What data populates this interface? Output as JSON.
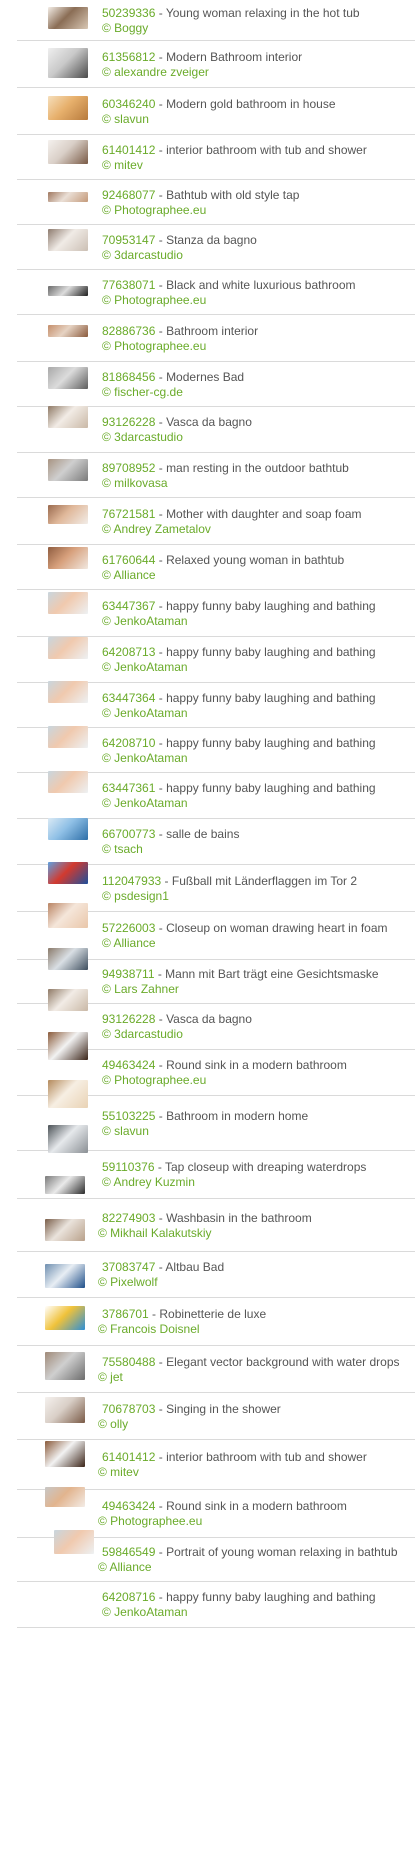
{
  "accent_color": "#6aab2a",
  "text_color": "#555555",
  "separator": " - ",
  "items": [
    {
      "id": "50239336",
      "title": "Young woman relaxing in the hot tub",
      "credit": "© Boggy",
      "thumb": "woman-hot-tub-thumbnail",
      "colors": [
        "#d8c7b4",
        "#8a6d55",
        "#f3ede6"
      ]
    },
    {
      "id": "61356812",
      "title": "Modern Bathroom interior",
      "credit": "© alexandre zveiger",
      "thumb": "bathroom-interior-thumbnail",
      "colors": [
        "#4a4a4a",
        "#c9c9c9",
        "#efefef"
      ]
    },
    {
      "id": "60346240",
      "title": "Modern gold bathroom in house",
      "credit": "© slavun",
      "thumb": "gold-bathroom-thumbnail",
      "colors": [
        "#b77a3c",
        "#e7b06c",
        "#f6dfbc"
      ]
    },
    {
      "id": "61401412",
      "title": "interior bathroom with tub and shower",
      "credit": "© mitev",
      "thumb": "bathroom-tub-shower-thumbnail",
      "colors": [
        "#7a5a46",
        "#d9cfc7",
        "#f5f1ee"
      ]
    },
    {
      "id": "92468077",
      "title": "Bathtub with old style tap",
      "credit": "© Photographee.eu",
      "thumb": "bathtub-tap-thumbnail",
      "colors": [
        "#c49a7a",
        "#eadfd6",
        "#a07860"
      ]
    },
    {
      "id": "70953147",
      "title": "Stanza da bagno",
      "credit": "© 3darcastudio",
      "thumb": "stanza-da-bagno-thumbnail",
      "colors": [
        "#cbbfb4",
        "#f0ebe6",
        "#8d7b6e"
      ]
    },
    {
      "id": "77638071",
      "title": "Black and white luxurious bathroom",
      "credit": "© Photographee.eu",
      "thumb": "black-white-bathroom-thumbnail",
      "colors": [
        "#1e1e1e",
        "#dcdcdc",
        "#6a6a6a"
      ]
    },
    {
      "id": "82886736",
      "title": "Bathroom interior",
      "credit": "© Photographee.eu",
      "thumb": "bathroom-interior-2-thumbnail",
      "colors": [
        "#8a5a3c",
        "#e6d3c3",
        "#c58e6b"
      ]
    },
    {
      "id": "81868456",
      "title": "Modernes Bad",
      "credit": "© fischer-cg.de",
      "thumb": "modernes-bad-thumbnail",
      "colors": [
        "#5e5e5e",
        "#dcdcdc",
        "#a8a8a8"
      ]
    },
    {
      "id": "93126228",
      "title": "Vasca da bagno",
      "credit": "© 3darcastudio",
      "thumb": "vasca-da-bagno-thumbnail",
      "colors": [
        "#c9b8a6",
        "#f2ece6",
        "#8f7a66"
      ]
    },
    {
      "id": "89708952",
      "title": "man resting in the outdoor bathtub",
      "credit": "© milkovasa",
      "thumb": "man-outdoor-bathtub-thumbnail",
      "colors": [
        "#7a7a7a",
        "#cfcfcf",
        "#a89482"
      ]
    },
    {
      "id": "76721581",
      "title": "Mother with daughter and soap foam",
      "credit": "© Andrey Zametalov",
      "thumb": "mother-daughter-foam-thumbnail",
      "colors": [
        "#f2ede8",
        "#e0b89a",
        "#9a6a4e"
      ]
    },
    {
      "id": "61760644",
      "title": "Relaxed young woman in bathtub",
      "credit": "© Alliance",
      "thumb": "woman-bathtub-thumbnail",
      "colors": [
        "#f1e8e0",
        "#d7a07c",
        "#8f5d40"
      ]
    },
    {
      "id": "63447367",
      "title": "happy funny baby laughing and bathing",
      "credit": "© JenkoAtaman",
      "thumb": "baby-bathing-thumbnail",
      "colors": [
        "#eef1f3",
        "#f0c9ae",
        "#c9d6de"
      ]
    },
    {
      "id": "64208713",
      "title": "happy funny baby laughing and bathing",
      "credit": "© JenkoAtaman",
      "thumb": "baby-bathing-thumbnail",
      "colors": [
        "#eef1f3",
        "#f0c9ae",
        "#c9d6de"
      ]
    },
    {
      "id": "63447364",
      "title": "happy funny baby laughing and bathing",
      "credit": "© JenkoAtaman",
      "thumb": "baby-bathing-thumbnail",
      "colors": [
        "#eef1f3",
        "#f0c9ae",
        "#c9d6de"
      ]
    },
    {
      "id": "64208710",
      "title": "happy funny baby laughing and bathing",
      "credit": "© JenkoAtaman",
      "thumb": "baby-bathing-thumbnail",
      "colors": [
        "#eef1f3",
        "#f0c9ae",
        "#c9d6de"
      ]
    },
    {
      "id": "63447361",
      "title": "happy funny baby laughing and bathing",
      "credit": "© JenkoAtaman",
      "thumb": "baby-bathing-thumbnail",
      "colors": [
        "#eef1f3",
        "#f0c9ae",
        "#c9d6de"
      ]
    },
    {
      "id": "66700773",
      "title": "salle de bains",
      "credit": "© tsach",
      "thumb": "salle-de-bains-thumbnail",
      "colors": [
        "#2e6fa8",
        "#8fc0e6",
        "#dbeaf5"
      ]
    },
    {
      "id": "112047933",
      "title": "Fußball mit Länderflaggen im Tor 2",
      "credit": "© psdesign1",
      "thumb": "football-flags-thumbnail",
      "colors": [
        "#1d4f9c",
        "#d23a2f",
        "#5fa0e0"
      ]
    },
    {
      "id": "57226003",
      "title": "Closeup on woman drawing heart in foam",
      "credit": "© Alliance",
      "thumb": "woman-heart-foam-thumbnail",
      "colors": [
        "#e9c6a9",
        "#f5e6da",
        "#b98464"
      ]
    },
    {
      "id": "94938711",
      "title": "Mann mit Bart trägt eine Gesichtsmaske",
      "credit": "© Lars Zahner",
      "thumb": "man-beard-mask-thumbnail",
      "colors": [
        "#3e4e5e",
        "#d9dfe4",
        "#8a7a6a"
      ]
    },
    {
      "id": "93126228",
      "title": "Vasca da bagno",
      "credit": "© 3darcastudio",
      "thumb": "vasca-da-bagno-thumbnail",
      "colors": [
        "#c9b8a6",
        "#f2ece6",
        "#8f7a66"
      ]
    },
    {
      "id": "49463424",
      "title": "Round sink in a modern bathroom",
      "credit": "© Photographee.eu",
      "thumb": "round-sink-thumbnail",
      "colors": [
        "#3b2418",
        "#f2f2f2",
        "#8a5a3a"
      ]
    },
    {
      "id": "55103225",
      "title": "Bathroom in modern home",
      "credit": "© slavun",
      "thumb": "bathroom-modern-home-thumbnail",
      "colors": [
        "#e9d2b4",
        "#f7efe3",
        "#b48a5c"
      ]
    },
    {
      "id": "59110376",
      "title": "Tap closeup with dreaping waterdrops",
      "credit": "© Andrey Kuzmin",
      "thumb": "tap-closeup-thumbnail",
      "colors": [
        "#8a8f94",
        "#e6e9ec",
        "#4b5156"
      ]
    },
    {
      "id": "82274903",
      "title": "Washbasin in the bathroom",
      "credit": "© Mikhail Kalakutskiy",
      "thumb": "washbasin-thumbnail",
      "colors": [
        "#2b2b2b",
        "#eaeaea",
        "#7a7a7a"
      ]
    },
    {
      "id": "37083747",
      "title": "Altbau Bad",
      "credit": "© Pixelwolf",
      "thumb": "altbau-bad-thumbnail",
      "colors": [
        "#b8a08a",
        "#eae3dc",
        "#7a5e4a"
      ]
    },
    {
      "id": "3786701",
      "title": "Robinetterie de luxe",
      "credit": "© Francois Doisnel",
      "thumb": "robinetterie-thumbnail",
      "colors": [
        "#1f4f8a",
        "#e8eef4",
        "#6f8fb0"
      ]
    },
    {
      "id": "75580488",
      "title": "Elegant vector background with water drops",
      "credit": "© jet",
      "thumb": "vector-water-drops-thumbnail",
      "colors": [
        "#2d8fd6",
        "#f0c23a",
        "#ffffff"
      ]
    },
    {
      "id": "70678703",
      "title": "Singing in the shower",
      "credit": "© olly",
      "thumb": "singing-shower-thumbnail",
      "colors": [
        "#6c6c6c",
        "#cfcfcf",
        "#a08a78"
      ]
    },
    {
      "id": "61401412",
      "title": "interior bathroom with tub and shower",
      "credit": "© mitev",
      "thumb": "bathroom-tub-shower-thumbnail",
      "colors": [
        "#7a5a46",
        "#d9cfc7",
        "#f5f1ee"
      ]
    },
    {
      "id": "49463424",
      "title": "Round sink in a modern bathroom",
      "credit": "© Photographee.eu",
      "thumb": "round-sink-thumbnail",
      "colors": [
        "#3b2418",
        "#f2f2f2",
        "#8a5a3a"
      ]
    },
    {
      "id": "59846549",
      "title": "Portrait of young woman relaxing in bathtub",
      "credit": "© Alliance",
      "thumb": "woman-relaxing-bathtub-thumbnail",
      "colors": [
        "#f3ece6",
        "#e2b48e",
        "#c7c7c7"
      ]
    },
    {
      "id": "64208716",
      "title": "happy funny baby laughing and bathing",
      "credit": "© JenkoAtaman",
      "thumb": "baby-bathing-thumbnail",
      "colors": [
        "#eef1f3",
        "#f0c9ae",
        "#c9d6de"
      ]
    }
  ]
}
